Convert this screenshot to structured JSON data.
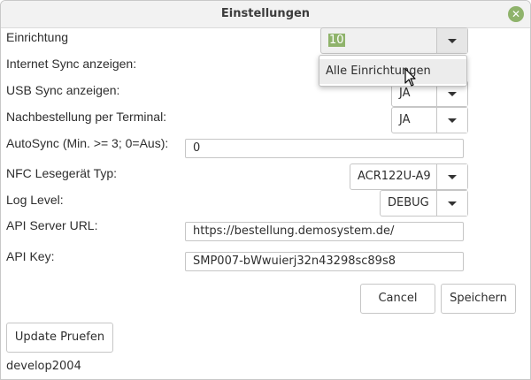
{
  "window": {
    "title": "Einstellungen",
    "close_icon": "close-icon",
    "accent_color": "#8fb36b"
  },
  "fields": {
    "einrichtung": {
      "label": "Einrichtung",
      "value": "10"
    },
    "internet_sync": {
      "label": "Internet Sync anzeigen:"
    },
    "usb_sync": {
      "label": "USB Sync anzeigen:",
      "value": "JA"
    },
    "nachbestellung": {
      "label": "Nachbestellung per Terminal:",
      "value": "JA"
    },
    "autosync": {
      "label": "AutoSync (Min. >= 3; 0=Aus):",
      "value": "0"
    },
    "nfc": {
      "label": "NFC Lesegerät Typ:",
      "value": "ACR122U-A9"
    },
    "log_level": {
      "label": "Log Level:",
      "value": "DEBUG"
    },
    "api_url": {
      "label": "API Server URL:",
      "value": "https://bestellung.demosystem.de/"
    },
    "api_key": {
      "label": "API Key:",
      "value": "SMP007-bWwuierj32n43298sc89s8"
    }
  },
  "dropdown": {
    "items": [
      "Alle Einrichtungen"
    ]
  },
  "buttons": {
    "cancel": "Cancel",
    "save": "Speichern",
    "update": "Update Pruefen"
  },
  "footer": {
    "version": "develop2004"
  }
}
